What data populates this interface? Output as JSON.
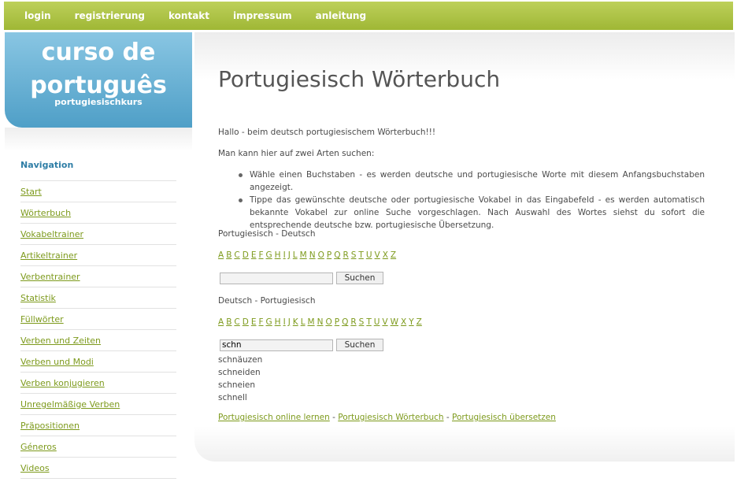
{
  "topnav": [
    "login",
    "registrierung",
    "kontakt",
    "impressum",
    "anleitung"
  ],
  "logo": {
    "line1": "curso de",
    "line2": "português",
    "subtitle": "portugiesischkurs"
  },
  "sidebar": {
    "title": "Navigation",
    "items": [
      "Start",
      "Wörterbuch",
      "Vokabeltrainer",
      "Artikeltrainer",
      "Verbentrainer",
      "Statistik",
      "Füllwörter",
      "Verben und Zeiten",
      "Verben und Modi",
      "Verben konjugieren",
      "Unregelmäßige Verben",
      "Präpositionen",
      "Géneros",
      "Videos"
    ]
  },
  "main": {
    "title": "Portugiesisch Wörterbuch",
    "intro1": "Hallo - beim deutsch portugiesischem Wörterbuch!!!",
    "intro2": "Man kann hier auf zwei Arten suchen:",
    "bullets": [
      "Wähle einen Buchstaben - es werden deutsche und portugiesische Worte mit diesem Anfangsbuchstaben angezeigt.",
      "Tippe das gewünschte deutsche oder portugiesische Vokabel in das Eingabefeld - es werden automatisch bekannte Vokabel zur online Suche vorgeschlagen. Nach Auswahl des Wortes siehst du sofort die entsprechende deutsche bzw. portugiesische Übersetzung."
    ],
    "section1": {
      "heading": "Portugiesisch - Deutsch",
      "letters": [
        "A",
        "B",
        "C",
        "D",
        "E",
        "F",
        "G",
        "H",
        "I",
        "J",
        "L",
        "M",
        "N",
        "O",
        "P",
        "Q",
        "R",
        "S",
        "T",
        "U",
        "V",
        "X",
        "Z"
      ],
      "input_value": "",
      "button": "Suchen"
    },
    "section2": {
      "heading": "Deutsch - Portugiesisch",
      "letters": [
        "A",
        "B",
        "C",
        "D",
        "E",
        "F",
        "G",
        "H",
        "I",
        "J",
        "K",
        "L",
        "M",
        "N",
        "O",
        "P",
        "Q",
        "R",
        "S",
        "T",
        "U",
        "V",
        "W",
        "X",
        "Y",
        "Z"
      ],
      "input_value": "schn",
      "button": "Suchen",
      "suggestions": [
        "schnäuzen",
        "schneiden",
        "schneien",
        "schnell"
      ]
    },
    "footer_links": [
      "Portugiesisch online lernen",
      "Portugiesisch Wörterbuch",
      "Portugiesisch übersetzen"
    ],
    "footer_sep": " - "
  }
}
